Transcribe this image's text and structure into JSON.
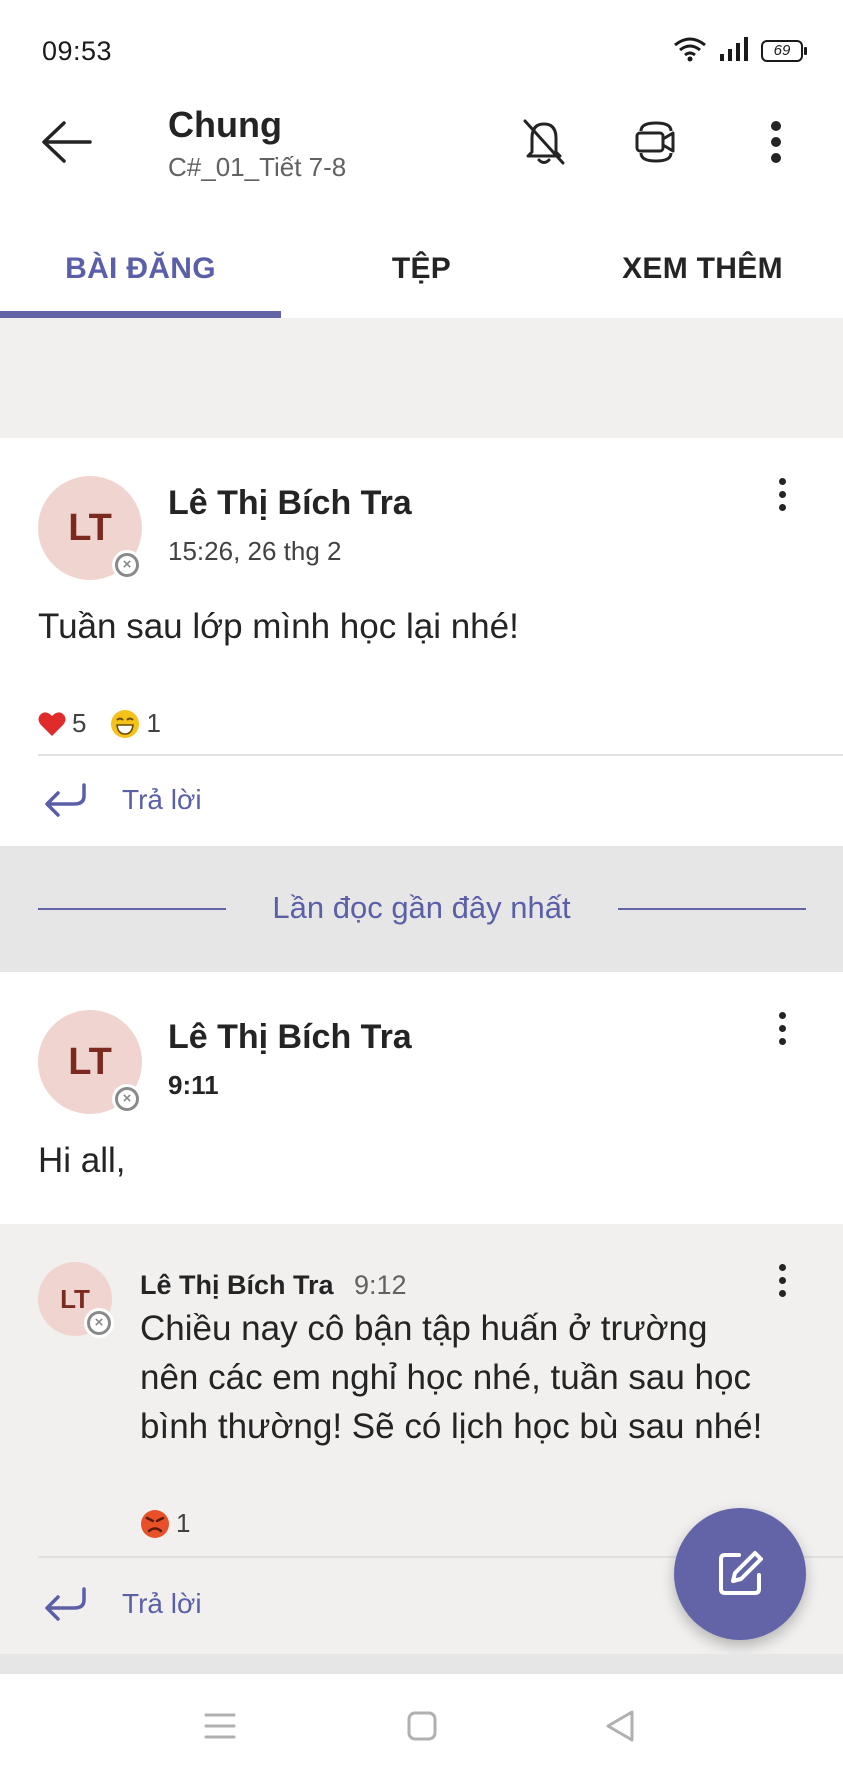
{
  "status_bar": {
    "time": "09:53",
    "battery": "69"
  },
  "header": {
    "title": "Chung",
    "subtitle": "C#_01_Tiết 7-8"
  },
  "tabs": [
    {
      "label": "BÀI ĐĂNG",
      "active": true
    },
    {
      "label": "TỆP",
      "active": false
    },
    {
      "label": "XEM THÊM",
      "active": false
    }
  ],
  "posts": [
    {
      "avatar": "LT",
      "author": "Lê Thị Bích Tra",
      "time": "15:26, 26 thg 2",
      "message": "Tuần sau lớp mình học lại nhé!",
      "reactions": [
        {
          "icon": "heart-icon",
          "count": "5"
        },
        {
          "icon": "grin-icon",
          "count": "1"
        }
      ],
      "reply_label": "Trả lời"
    },
    {
      "avatar": "LT",
      "author": "Lê Thị Bích Tra",
      "time": "9:11",
      "message": "Hi all,",
      "reply": {
        "avatar": "LT",
        "author": "Lê Thị Bích Tra",
        "time": "9:12",
        "message_lines": [
          "Chiều nay cô bận tập huấn ở trường",
          "nên các em nghỉ học nhé, tuần sau học",
          "bình thường! Sẽ có lịch học bù sau nhé!"
        ],
        "reactions": [
          {
            "icon": "angry-icon",
            "count": "1"
          }
        ]
      },
      "reply_label": "Trả lời"
    }
  ],
  "read_marker": "Lần đọc gần đây nhất",
  "colors": {
    "accent": "#6264a7",
    "avatar_bg": "#f0d4cf",
    "avatar_text": "#7a2a1f"
  }
}
